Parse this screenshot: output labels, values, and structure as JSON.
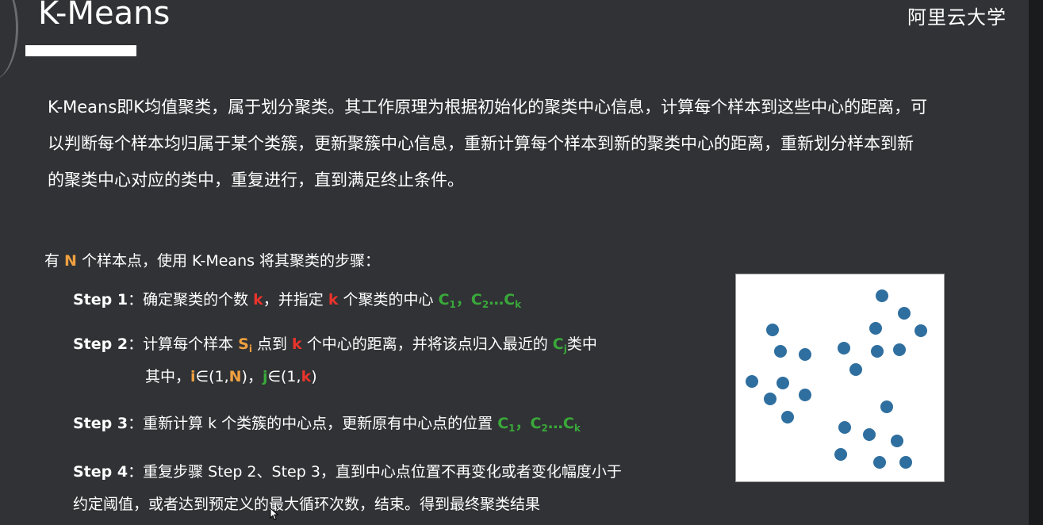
{
  "slide": {
    "title": "K-Means",
    "logo_text": "阿里云大学",
    "intro": "K-Means即K均值聚类，属于划分聚类。其工作原理为根据初始化的聚类中心信息，计算每个样本到这些中心的距离，可以判断每个样本均归属于某个类簇，更新聚簇中心信息，重新计算每个样本到新的聚类中心的距离，重新划分样本到新的聚类中心对应的类中，重复进行，直到满足终止条件。",
    "steps_heading": {
      "pre": "有 ",
      "n": "N",
      "post": " 个样本点，使用 K-Means 将其聚类的步骤："
    },
    "step1": {
      "label": "Step 1",
      "t1": "：确定聚类的个数 ",
      "k1": "k",
      "t2": "，并指定 ",
      "k2": "k",
      "t3": " 个聚类的中心 ",
      "c1": "C",
      "c1_sub": "1",
      "sep": "，",
      "c2": "C",
      "c2_sub": "2",
      "dots": "…C",
      "ck_sub": "k"
    },
    "step2": {
      "label": "Step 2",
      "t1": "：计算每个样本 ",
      "s": "S",
      "s_sub": "i",
      "t2": " 点到 ",
      "k": "k",
      "t3": " 个中心的距离，并将该点归入最近的 ",
      "c": "C",
      "c_sub": "j",
      "t4": "类中",
      "line2_pre": "其中，",
      "i": "i",
      "in1": "∈(1,",
      "n": "N",
      "close1": ")，",
      "j": "j",
      "in2": "∈(1,",
      "k2": "k",
      "close2": ")"
    },
    "step3": {
      "label": "Step 3",
      "t1": "：重新计算 k 个类簇的中心点，更新原有中心点的位置 ",
      "c1": "C",
      "c1_sub": "1",
      "sep": "，",
      "c2": "C",
      "c2_sub": "2",
      "dots": "…C",
      "ck_sub": "k"
    },
    "step4": {
      "label": "Step 4",
      "t1": "：重复步骤 Step 2、Step 3，直到中心点位置不再变化或者变化幅度小于",
      "line2": "约定阈值，或者达到预定义的最大循环次数，结束。得到最终聚类结果"
    }
  },
  "colors": {
    "background": "#303235",
    "highlight_red": "#e8342c",
    "highlight_green": "#3aa83a",
    "highlight_orange": "#f0a040",
    "point_blue": "#2f6f9f",
    "logo_orange": "#f07a10"
  },
  "chart_data": {
    "type": "scatter",
    "xlim": [
      0,
      262
    ],
    "ylim": [
      0,
      261
    ],
    "points": [
      [
        184,
        27
      ],
      [
        212,
        49
      ],
      [
        233,
        71
      ],
      [
        176,
        68
      ],
      [
        46,
        70
      ],
      [
        56,
        97
      ],
      [
        87,
        101
      ],
      [
        136,
        93
      ],
      [
        178,
        97
      ],
      [
        206,
        95
      ],
      [
        151,
        120
      ],
      [
        20,
        135
      ],
      [
        59,
        137
      ],
      [
        43,
        157
      ],
      [
        87,
        152
      ],
      [
        65,
        180
      ],
      [
        190,
        167
      ],
      [
        137,
        193
      ],
      [
        168,
        202
      ],
      [
        203,
        210
      ],
      [
        132,
        227
      ],
      [
        181,
        237
      ],
      [
        214,
        237
      ]
    ]
  }
}
